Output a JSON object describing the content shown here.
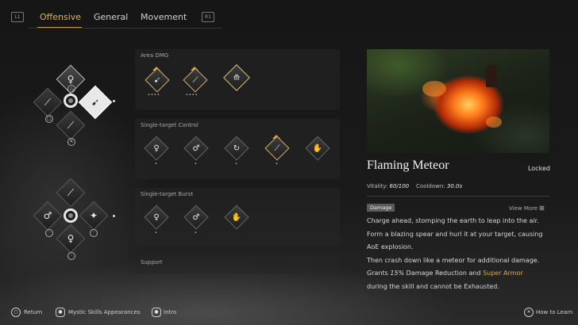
{
  "topbar": {
    "left_badge": "L1",
    "right_badge": "R1",
    "tabs": [
      {
        "label": "Offensive",
        "active": true
      },
      {
        "label": "General",
        "active": false
      },
      {
        "label": "Movement",
        "active": false
      }
    ]
  },
  "sections": [
    {
      "title": "Area DMG",
      "skills": [
        {
          "icon": "spear-sweep-icon",
          "active": true,
          "dots": "••••"
        },
        {
          "icon": "slash-lunge-icon",
          "active": true,
          "dots": "••••"
        },
        {
          "icon": "flaming-meteor-icon",
          "active": true,
          "dots": ""
        }
      ]
    },
    {
      "title": "Single-target Control",
      "skills": [
        {
          "icon": "grapple-icon",
          "dots": "•"
        },
        {
          "icon": "kick-icon",
          "dots": "•"
        },
        {
          "icon": "spin-icon",
          "dots": "•"
        },
        {
          "icon": "thrust-icon",
          "dots": "•"
        },
        {
          "icon": "palm-icon",
          "dots": ""
        }
      ]
    },
    {
      "title": "Single-target Burst",
      "skills": [
        {
          "icon": "leap-strike-icon",
          "dots": "•"
        },
        {
          "icon": "pierce-icon",
          "dots": "•"
        },
        {
          "icon": "burst-icon",
          "dots": ""
        }
      ]
    },
    {
      "title": "Support",
      "skills": []
    }
  ],
  "detail": {
    "name": "Flaming Meteor",
    "status": "Locked",
    "vitality_label": "Vitality:",
    "vitality_value": "60/100",
    "cooldown_label": "Cooldown:",
    "cooldown_value": "30.0s",
    "tag": "Damage",
    "view_more": "View More",
    "desc_lines": [
      "Charge ahead, stomping the earth to leap into the air.",
      "Form a blazing spear and hurl it at your target, causing",
      "AoE explosion.",
      "Then crash down like a meteor for additional damage."
    ],
    "desc_grants_pre": "Grants ",
    "desc_grants_value": "15%",
    "desc_grants_mid": " Damage Reduction and ",
    "desc_grants_hl": "Super Armor",
    "desc_last": "during the skill and cannot be Exhausted."
  },
  "bottombar": {
    "return_label": "Return",
    "appearances_label": "Mystic Skills Appearances",
    "intro_label": "Intro",
    "leave_label": "How to Learn"
  },
  "colors": {
    "accent": "#e0b35a",
    "highlight": "#e0a84a"
  }
}
